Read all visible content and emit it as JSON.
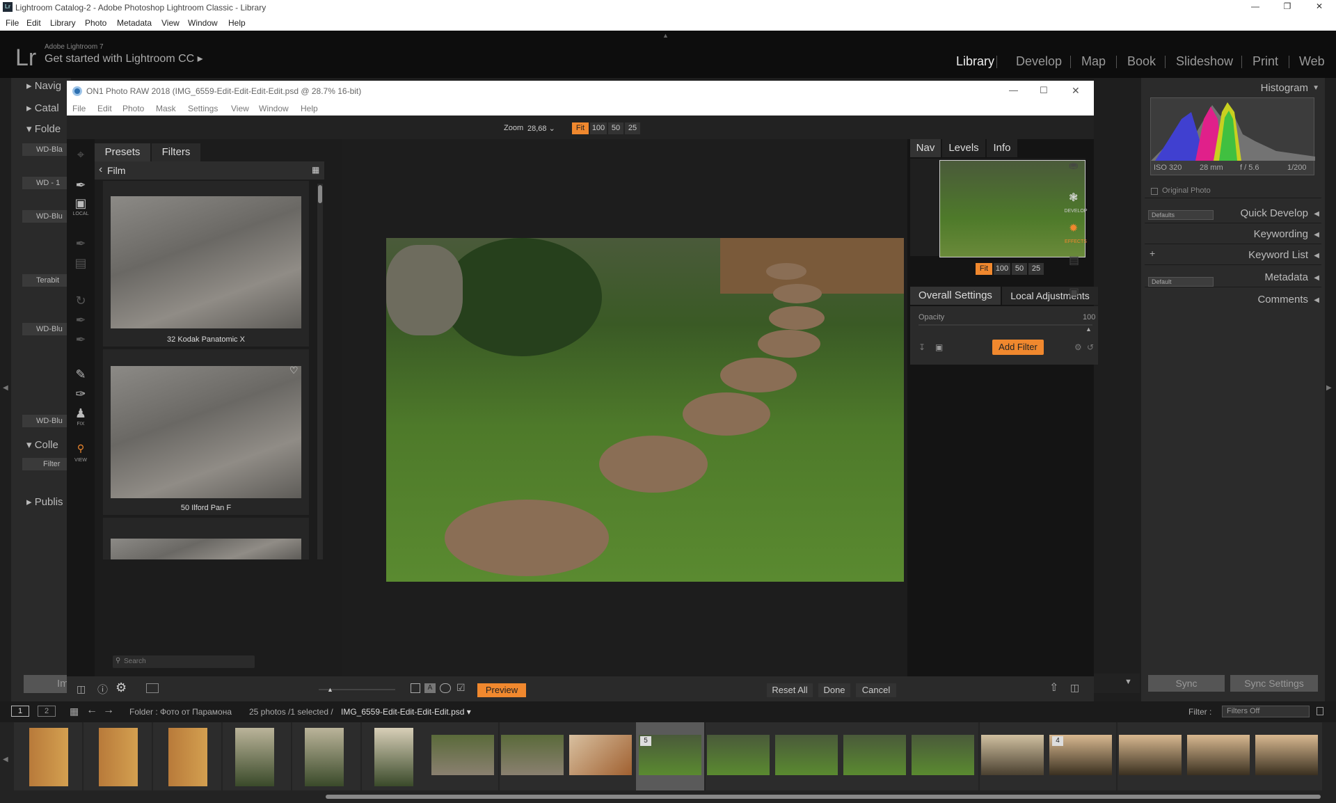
{
  "lr": {
    "title": "Lightroom Catalog-2 - Adobe Photoshop Lightroom Classic - Library",
    "icon": "Lr",
    "menu": [
      "File",
      "Edit",
      "Library",
      "Photo",
      "Metadata",
      "View",
      "Window",
      "Help"
    ],
    "brand_small": "Adobe Lightroom 7",
    "brand_big": "Get started with Lightroom CC",
    "modules": [
      "Library",
      "Develop",
      "Map",
      "Book",
      "Slideshow",
      "Print",
      "Web"
    ],
    "active_module": "Library",
    "left_panels": [
      "Navig",
      "Catal",
      "Folde",
      "Colle",
      "Publis"
    ],
    "folder_rows": [
      "WD-Bla",
      "WD - 1",
      "WD-Blu",
      "Terabit",
      "WD-Blu",
      "WD-Blu"
    ],
    "filter_label": "Filter",
    "import_label": "Impo",
    "right": {
      "histogram": "Histogram",
      "iso": "ISO 320",
      "focal": "28 mm",
      "aperture": "f / 5.6",
      "shutter": "1/200",
      "original_photo": "Original Photo",
      "defaults": "Defaults",
      "quick_develop": "Quick Develop",
      "keywording": "Keywording",
      "keyword_list": "Keyword List",
      "default": "Default",
      "metadata": "Metadata",
      "comments": "Comments",
      "sync": "Sync",
      "sync_settings": "Sync Settings"
    },
    "filmbar": {
      "page1": "1",
      "page2": "2",
      "folder": "Folder : Фото от Парамона",
      "count": "25 photos /1 selected /",
      "filename": "IMG_6559-Edit-Edit-Edit-Edit.psd",
      "filter_label": "Filter :",
      "filter_value": "Filters Off"
    },
    "thumb_badges": [
      "5",
      "4"
    ]
  },
  "on1": {
    "title": "ON1 Photo RAW 2018 (IMG_6559-Edit-Edit-Edit-Edit.psd @ 28.7% 16-bit)",
    "menu": [
      "File",
      "Edit",
      "Photo",
      "Mask",
      "Settings",
      "View",
      "Window",
      "Help"
    ],
    "zoom_label": "Zoom",
    "zoom_value": "28,68",
    "zoom_buttons": [
      "Fit",
      "100",
      "50",
      "25"
    ],
    "tabs": [
      "Presets",
      "Filters"
    ],
    "category": "Film",
    "presets": [
      "32 Kodak Panatomic X",
      "50 Ilford Pan F"
    ],
    "search_placeholder": "Search",
    "tools": [
      "LOCAL",
      "FIX",
      "VIEW"
    ],
    "right_tabs": [
      "Nav",
      "Levels",
      "Info"
    ],
    "settings_tabs": [
      "Overall Settings",
      "Local Adjustments"
    ],
    "opacity_label": "Opacity",
    "opacity_value": "100",
    "add_filter": "Add Filter",
    "side_labels": [
      "DEVELOP",
      "EFFECTS"
    ],
    "preview": "Preview",
    "reset_all": "Reset All",
    "done": "Done",
    "cancel": "Cancel"
  }
}
